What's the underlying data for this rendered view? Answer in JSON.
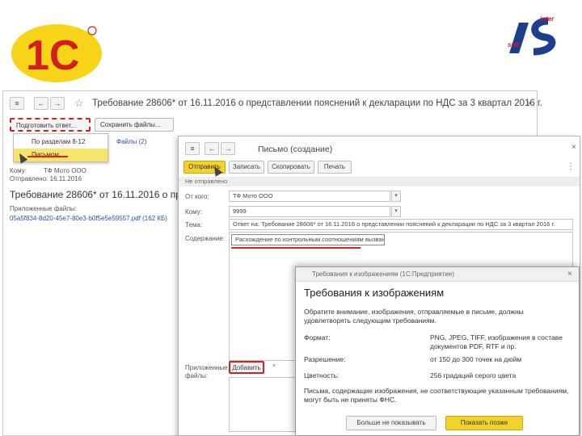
{
  "logos": {
    "left_logo_text": "1C",
    "right_logo_top": "inter",
    "right_logo_letters": "IS",
    "right_logo_bottom": "soft"
  },
  "main_window": {
    "back_label": "←",
    "forward_label": "→",
    "title": "Требование 28606* от 16.11.2016 о представлении пояснений к декларации по НДС за 3 квартал 2016 г.",
    "prepare_reply_label": "Подготовить ответ...",
    "save_files_label": "Сохранить файлы...",
    "dropdown_items": [
      "По разделам 8-12",
      "Письмом"
    ],
    "link_text": "Файлы (2)",
    "sender_label": "Кому:",
    "sender_value": "ТФ Мото ООО",
    "sent_label": "Отправлено: 16.11.2016",
    "heading": "Требование 28606* от 16.11.2016 о предс",
    "attachments_label": "Приложенные файлы:",
    "attachment_link": "05a5f834-8d20-45e7-80e3-b0f5e5e59557.pdf (162 КБ)"
  },
  "letter_window": {
    "title": "Письмо (создание)",
    "send_label": "Отправить",
    "save_label": "Записать",
    "copy_label": "Скопировать",
    "print_label": "Печать",
    "status": "Не отправлено",
    "from_label": "От кого:",
    "from_value": "ТФ Мото ООО",
    "to_label": "Кому:",
    "to_value": "9999",
    "subject_label": "Тема:",
    "subject_value": "Ответ на: Требование 28606* от 16.11.2016 о представлении пояснений к декларации по НДС за 3 квартал 2016 г.",
    "content_label": "Содержание:",
    "content_value": "Расхождение по контрольным соотношениям вызвано ...",
    "attached_label": "Приложенные файлы:",
    "add_label": "Добавить"
  },
  "requirements_window": {
    "header_title": "Требования к изображениям (1С:Предприятие)",
    "heading": "Требования к изображениям",
    "intro": "Обратите внимание, изображения, отправляемые в письме, должны удовлетворять следующим требованиям.",
    "rows": [
      {
        "key": "Формат:",
        "value": "PNG, JPEG, TIFF, изображения в составе документов PDF, RTF и пр."
      },
      {
        "key": "Разрешение:",
        "value": "от 150 до 300 точек на дюйм"
      },
      {
        "key": "Цветность:",
        "value": "256 градаций серого цвета"
      }
    ],
    "warning": "Письма, содержащие изображения, не соответствующие указанным требованиям, могут быть не приняты ФНС.",
    "dont_show_label": "Больше не показывать",
    "show_later_label": "Показать позже"
  },
  "colors": {
    "accent_yellow": "#f2d22b",
    "red_marker": "#d32020",
    "link_blue": "#2b4fa8"
  }
}
